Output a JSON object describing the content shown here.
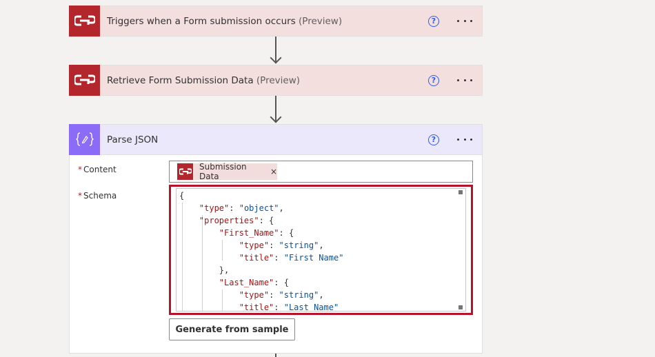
{
  "steps": [
    {
      "title": "Triggers when a Form submission occurs",
      "suffix": " (Preview)",
      "help": "?"
    },
    {
      "title": "Retrieve Form Submission Data",
      "suffix": " (Preview)",
      "help": "?"
    },
    {
      "title": "Parse JSON",
      "suffix": "",
      "help": "?"
    }
  ],
  "parse_json": {
    "content_label": "Content",
    "schema_label": "Schema",
    "required_marker": "*",
    "token_label": "Submission Data",
    "token_remove": "×",
    "schema_lines": [
      "{",
      "    \"type\": \"object\",",
      "    \"properties\": {",
      "        \"First_Name\": {",
      "            \"type\": \"string\",",
      "            \"title\": \"First Name\"",
      "        },",
      "        \"Last_Name\": {",
      "            \"type\": \"string\",",
      "            \"title\": \"Last Name\""
    ],
    "generate_button": "Generate from sample"
  },
  "colors": {
    "connector_brand": "#b3262b",
    "parse_json_brand": "#8a6cf7",
    "highlight_border": "#b5122b",
    "help_icon": "#2f5de8"
  },
  "icons": {
    "connector": "cognito-forms-logo-icon",
    "parse_json": "curly-braces-icon",
    "help": "question-circle-icon",
    "more": "ellipsis-icon"
  }
}
